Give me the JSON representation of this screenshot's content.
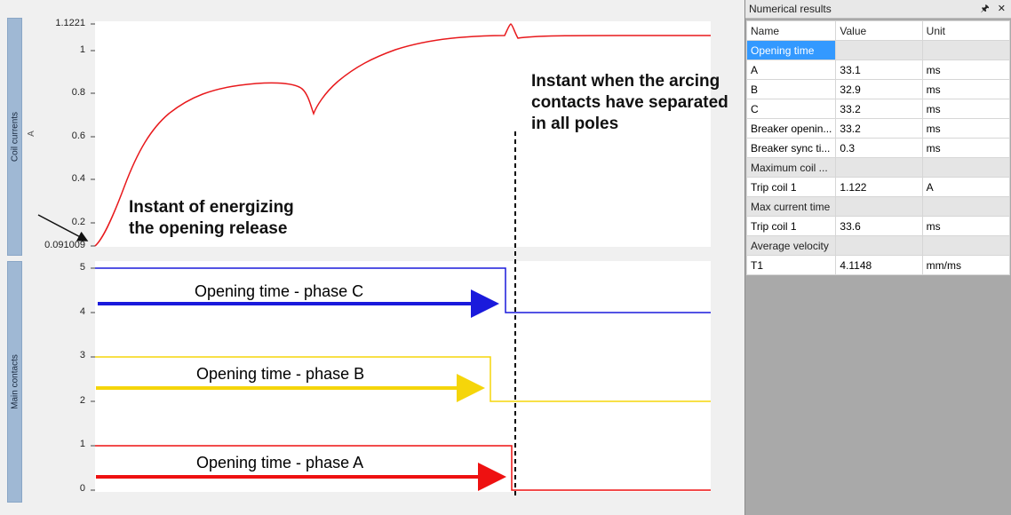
{
  "top_chart": {
    "axis_title": "Coil currents",
    "unit": "A",
    "yticks": [
      "1.1221",
      "1",
      "0.8",
      "0.6",
      "0.4",
      "0.2",
      "0.091009"
    ],
    "annotation_energize": "Instant of energizing\nthe opening release",
    "annotation_separation": "Instant when the arcing\ncontacts have separated\nin all poles",
    "colors": {
      "trace": "#e8191c"
    }
  },
  "bottom_chart": {
    "axis_title": "Main contacts",
    "yticks": [
      "5",
      "4",
      "3",
      "2",
      "1",
      "0"
    ],
    "phase_c_label": "Opening time - phase C",
    "phase_b_label": "Opening time - phase B",
    "phase_a_label": "Opening time - phase A",
    "colors": {
      "phase_c": "#1a1adc",
      "phase_b": "#f5d50a",
      "phase_a": "#ee1111"
    }
  },
  "results_panel": {
    "title": "Numerical results",
    "pin_icon": "pin-icon",
    "close_icon": "close-icon",
    "columns": [
      "Name",
      "Value",
      "Unit"
    ],
    "rows": [
      {
        "type": "group",
        "name": "Opening time",
        "selected": true
      },
      {
        "type": "item",
        "name": "A",
        "value": "33.1",
        "unit": "ms"
      },
      {
        "type": "item",
        "name": "B",
        "value": "32.9",
        "unit": "ms"
      },
      {
        "type": "item",
        "name": "C",
        "value": "33.2",
        "unit": "ms"
      },
      {
        "type": "item",
        "name": "Breaker openin...",
        "value": "33.2",
        "unit": "ms"
      },
      {
        "type": "item",
        "name": "Breaker sync ti...",
        "value": "0.3",
        "unit": "ms"
      },
      {
        "type": "group",
        "name": "Maximum coil ..."
      },
      {
        "type": "item",
        "name": "Trip coil 1",
        "value": "1.122",
        "unit": "A"
      },
      {
        "type": "group",
        "name": "Max current time"
      },
      {
        "type": "item",
        "name": "Trip coil 1",
        "value": "33.6",
        "unit": "ms"
      },
      {
        "type": "group",
        "name": "Average velocity"
      },
      {
        "type": "item",
        "name": "T1",
        "value": "4.1148",
        "unit": "mm/ms"
      }
    ]
  }
}
